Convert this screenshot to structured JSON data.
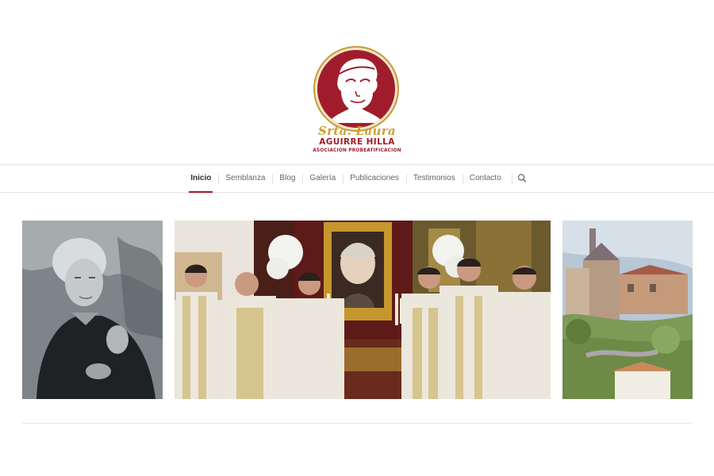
{
  "logo": {
    "script_text": "Srta. Laura",
    "name_text": "AGUIRRE HILLA",
    "subtitle_text": "ASOCIACION PROBEATIFICACION",
    "colors": {
      "primary": "#a01c2c",
      "gold": "#c9a233"
    }
  },
  "nav": {
    "items": [
      {
        "label": "Inicio",
        "active": true
      },
      {
        "label": "Semblanza",
        "active": false
      },
      {
        "label": "Blog",
        "active": false
      },
      {
        "label": "Galería",
        "active": false
      },
      {
        "label": "Publicaciones",
        "active": false
      },
      {
        "label": "Testimonios",
        "active": false
      },
      {
        "label": "Contacto",
        "active": false
      }
    ],
    "search_icon": "search-icon",
    "accent_color": "#a01c2c"
  },
  "gallery": {
    "images": [
      {
        "subject": "black-and-white portrait of an elderly woman"
      },
      {
        "subject": "group of priests in white vestments beside a framed portrait on an altar"
      },
      {
        "subject": "impressionist painting of a village church"
      }
    ]
  }
}
